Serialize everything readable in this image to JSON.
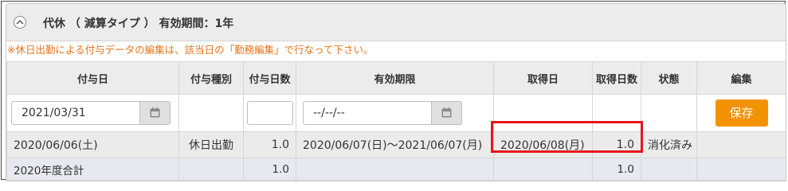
{
  "header": {
    "title": "代休 （ 減算タイプ ） 有効期間：1年"
  },
  "notice": "※休日出勤による付与データの編集は、該当日の「勤務編集」で行なって下さい。",
  "columns": {
    "grant_date": "付与日",
    "grant_type": "付与種別",
    "grant_days": "付与日数",
    "validity": "有効期限",
    "acquired_date": "取得日",
    "acquired_days": "取得日数",
    "status": "状態",
    "edit": "編集"
  },
  "input_row": {
    "grant_date_value": "2021/03/31",
    "validity_value": "--/--/--",
    "save_label": "保存"
  },
  "data_row": {
    "grant_date": "2020/06/06(土)",
    "grant_type": "休日出勤",
    "grant_days": "1.0",
    "validity": "2020/06/07(日)～2021/06/07(月)",
    "acquired_date": "2020/06/08(月)",
    "acquired_days": "1.0",
    "status": "消化済み"
  },
  "total_row": {
    "label": "2020年度合計",
    "grant_days": "1.0",
    "acquired_days": "1.0"
  },
  "colors": {
    "accent": "#f39200",
    "notice": "#e8741a",
    "highlight": "#e8141c"
  },
  "icons": [
    "chevron-up-icon",
    "calendar-icon"
  ]
}
